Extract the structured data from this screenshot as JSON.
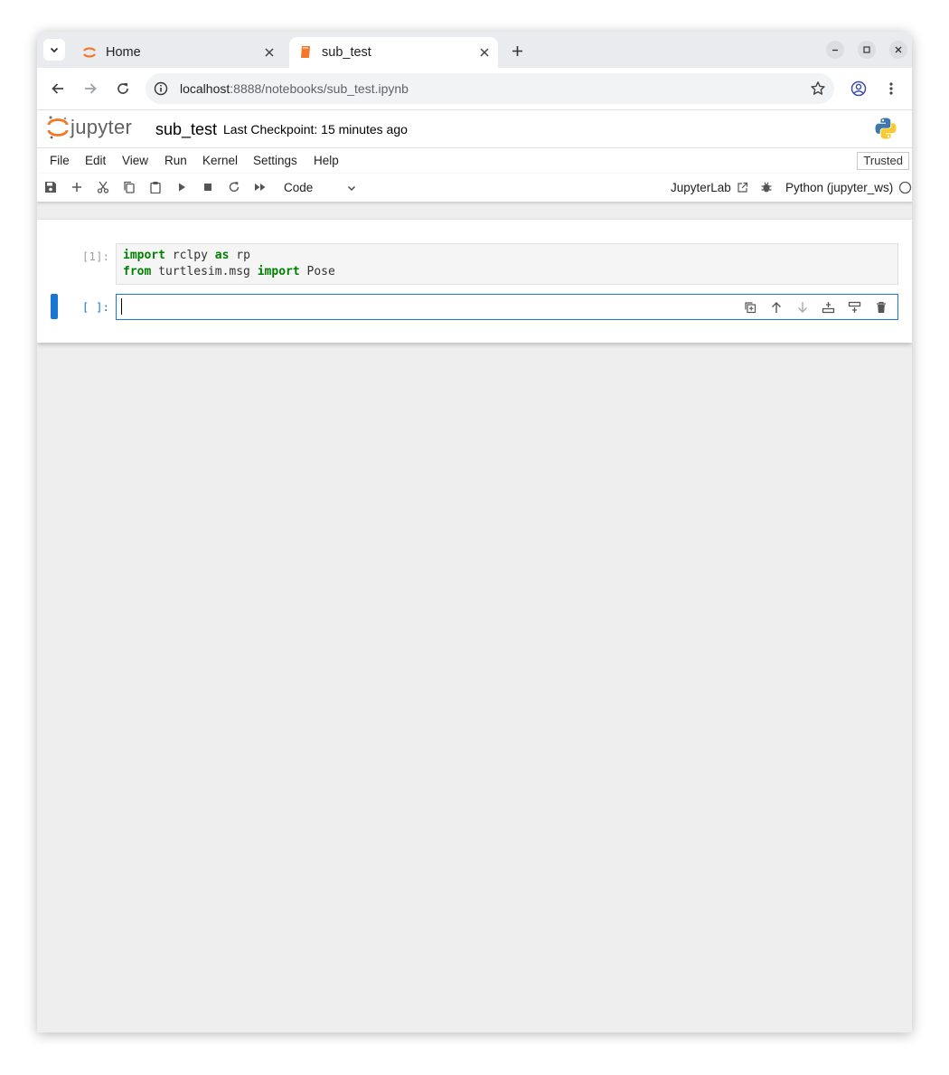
{
  "browser": {
    "tabs": [
      {
        "title": "Home",
        "active": false
      },
      {
        "title": "sub_test",
        "active": true
      }
    ],
    "url_host": "localhost",
    "url_rest": ":8888/notebooks/sub_test.ipynb"
  },
  "jupyter": {
    "logo_text": "jupyter",
    "notebook_name": "sub_test",
    "checkpoint": "Last Checkpoint: 15 minutes ago",
    "menu": [
      "File",
      "Edit",
      "View",
      "Run",
      "Kernel",
      "Settings",
      "Help"
    ],
    "trusted_label": "Trusted",
    "cell_type": "Code",
    "jupyterlab_label": "JupyterLab",
    "kernel_name": "Python (jupyter_ws)"
  },
  "cells": [
    {
      "prompt": "[1]:",
      "lines": [
        [
          {
            "t": "import",
            "kw": true
          },
          {
            "t": " rclpy ",
            "kw": false
          },
          {
            "t": "as",
            "kw": true
          },
          {
            "t": " rp",
            "kw": false
          }
        ],
        [
          {
            "t": "from",
            "kw": true
          },
          {
            "t": " turtlesim.msg ",
            "kw": false
          },
          {
            "t": "import",
            "kw": true
          },
          {
            "t": " Pose",
            "kw": false
          }
        ]
      ]
    },
    {
      "prompt": "[ ]:",
      "lines": []
    }
  ],
  "colors": {
    "accent": "#1976d2",
    "keyword": "#008000",
    "jupyter_orange": "#f37726"
  }
}
